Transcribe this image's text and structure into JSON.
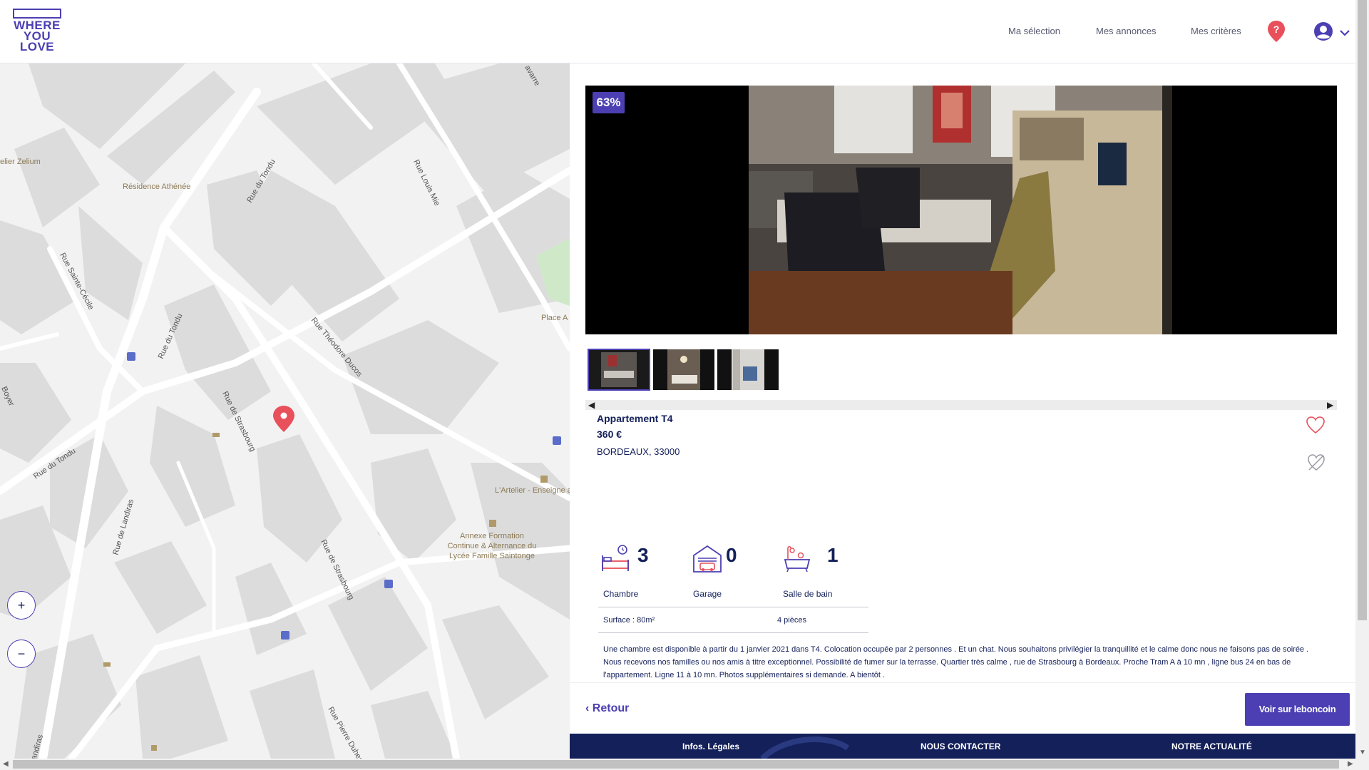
{
  "header": {
    "logo_lines": [
      "WHERE",
      "YOU",
      "LOVE"
    ],
    "nav": [
      "Ma sélection",
      "Mes annonces",
      "Mes critères"
    ],
    "help_icon": "question-pin-icon",
    "user_icon": "user-circle-icon",
    "chevron_icon": "chevron-down-icon"
  },
  "map": {
    "street_labels": [
      "Rue du Tondu",
      "Rue du Tondu",
      "Rue du Tondu",
      "Rue Sainte-Cécile",
      "Rue Théodore Ducos",
      "Rue de Strasbourg",
      "Rue de Strasbourg",
      "Rue de Landiras",
      "Rue de Landiras",
      "Rue Pierre Duhem",
      "Rue Louis Mie",
      "Boyer",
      "avarre"
    ],
    "poi_labels": [
      "elier Zelium",
      "Résidence Athénée",
      "Place A",
      "L'Artelier - Enseigne artistique",
      "Annexe Formation Continue & Alternance du Lycée Famille Saintonge"
    ],
    "zoom_in": "+",
    "zoom_out": "−",
    "marker_icon": "map-pin-icon"
  },
  "listing": {
    "photo_badge": "63%",
    "title": "Appartement T4",
    "price": "360 €",
    "city": "BORDEAUX, 33000",
    "features": [
      {
        "icon": "bed-icon",
        "count": "3",
        "label": "Chambre"
      },
      {
        "icon": "garage-icon",
        "count": "0",
        "label": "Garage"
      },
      {
        "icon": "bathtub-icon",
        "count": "1",
        "label": "Salle de bain"
      }
    ],
    "surface": "Surface : 80m²",
    "rooms": "4 pièces",
    "description": "Une chambre est disponible à partir du 1 janvier 2021 dans T4. Colocation occupée par 2 personnes . Et un chat. Nous souhaitons privilégier la tranquillité et le calme donc nous ne faisons pas de soirée . Nous recevons nos familles ou nos amis à titre exceptionnel. Possibilité de fumer sur la terrasse. Quartier très calme , rue de Strasbourg à Bordeaux. Proche Tram A à 10 mn , ligne bus 24 en bas de l'appartement. Ligne 11 à 10 mn. Photos supplémentaires si demande. A bientôt ."
  },
  "actions": {
    "back": "Retour",
    "leboncoin": "Voir sur leboncoin"
  },
  "footer": {
    "legal": "Infos. Légales",
    "contact": "NOUS CONTACTER",
    "news": "NOTRE ACTUALITÉ"
  },
  "colors": {
    "brand": "#4b3fb3",
    "navy": "#14205a",
    "marker": "#e8505b"
  }
}
